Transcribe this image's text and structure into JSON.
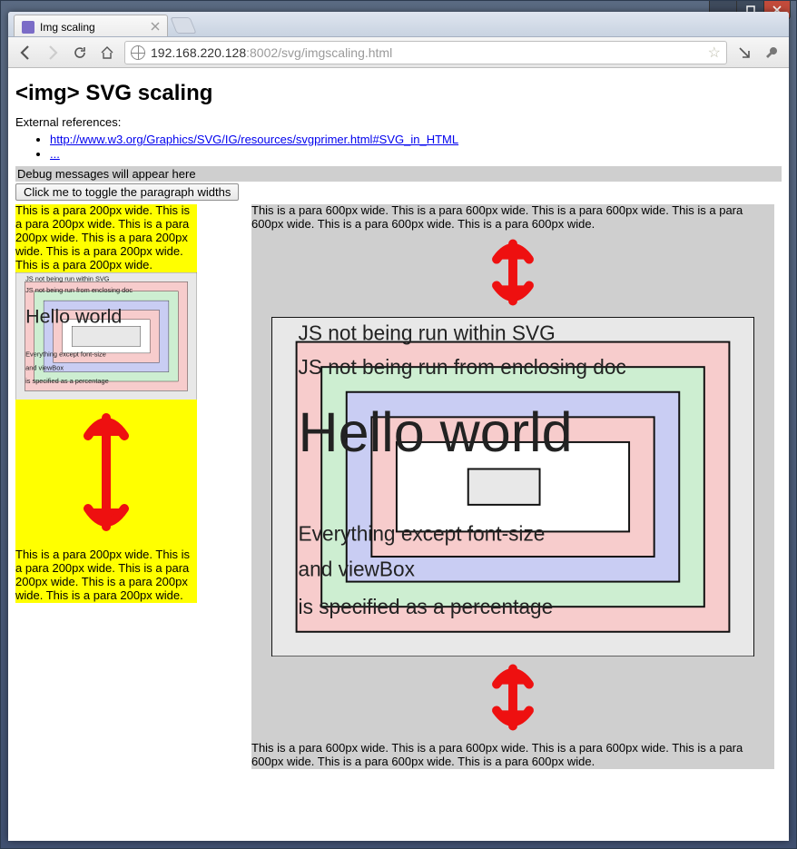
{
  "window": {
    "tab_title": "Img scaling",
    "url_host": "192.168.220.128",
    "url_port": ":8002",
    "url_path": "/svg/imgscaling.html"
  },
  "page": {
    "title": "<img> SVG scaling",
    "ext_ref_label": "External references:",
    "links": [
      {
        "text": "http://www.w3.org/Graphics/SVG/IG/resources/svgprimer.html#SVG_in_HTML"
      },
      {
        "text": "..."
      }
    ],
    "debug_text": "Debug messages will appear here",
    "toggle_label": "Click me to toggle the paragraph widths"
  },
  "col200": {
    "para_top": "This is a para 200px wide. This is a para 200px wide. This is a para 200px wide. This is a para 200px wide. This is a para 200px wide. This is a para 200px wide.",
    "para_bottom": "This is a para 200px wide. This is a para 200px wide. This is a para 200px wide. This is a para 200px wide. This is a para 200px wide."
  },
  "col600": {
    "para_top": "This is a para 600px wide. This is a para 600px wide. This is a para 600px wide. This is a para 600px wide. This is a para 600px wide. This is a para 600px wide.",
    "para_bottom": "This is a para 600px wide. This is a para 600px wide. This is a para 600px wide. This is a para 600px wide. This is a para 600px wide. This is a para 600px wide."
  },
  "svg": {
    "line_js1": "JS not being run within SVG",
    "line_js2": "JS not being run from enclosing doc",
    "line_hello": "Hello world",
    "line_sub1": "Everything except font-size",
    "line_sub2": "and viewBox",
    "line_sub3": "is specified as a percentage"
  }
}
